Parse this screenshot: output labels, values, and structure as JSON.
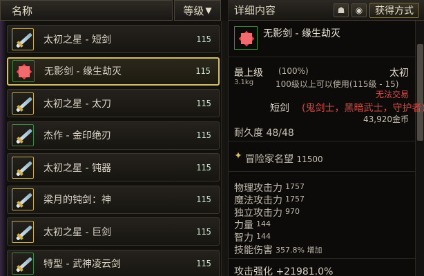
{
  "list": {
    "header": {
      "name_label": "名称",
      "level_label": "等级"
    },
    "items": [
      {
        "name": "太初之星 - 短剑",
        "level": "115",
        "icon": "sword-icon",
        "frame": "gold",
        "selected": false
      },
      {
        "name": "无影剑 - 缘生劫灭",
        "level": "115",
        "icon": "red-burst-icon",
        "frame": "green",
        "selected": true
      },
      {
        "name": "太初之星 - 太刀",
        "level": "115",
        "icon": "sword-icon",
        "frame": "gold",
        "selected": false
      },
      {
        "name": "杰作 - 金印绝刃",
        "level": "115",
        "icon": "sword-icon",
        "frame": "green",
        "selected": false
      },
      {
        "name": "太初之星 - 钝器",
        "level": "115",
        "icon": "sword-icon",
        "frame": "gold",
        "selected": false
      },
      {
        "name": "梁月的钝剑：神",
        "level": "115",
        "icon": "sword-icon",
        "frame": "gold",
        "selected": false
      },
      {
        "name": "太初之星 - 巨剑",
        "level": "115",
        "icon": "sword-icon",
        "frame": "gold",
        "selected": false
      },
      {
        "name": "特型 - 武神凌云剑",
        "level": "115",
        "icon": "sword-icon",
        "frame": "green",
        "selected": false
      }
    ]
  },
  "detail": {
    "header_title": "详细内容",
    "btn_a": "☗",
    "btn_b": "◉",
    "obtain_label": "获得方式",
    "item_name": "无影剑 - 缘生劫灭",
    "grade_label": "最上级",
    "grade_pct": "(100%)",
    "grade_suffix": "太初",
    "weight": "3.1kg",
    "usable": "100级以上可以使用(115级 - 15)",
    "no_trade": "无法交易",
    "weapon_type": "短剑",
    "classes": "(鬼剑士，黑暗武士，守护者)",
    "price": "43,920金币",
    "durability": "耐久度 48/48",
    "fame_label": "冒险家名望",
    "fame_value": "11500",
    "stats": [
      {
        "label": "物理攻击力",
        "value": "1757"
      },
      {
        "label": "魔法攻击力",
        "value": "1757"
      },
      {
        "label": "独立攻击力",
        "value": "970"
      },
      {
        "label": "力量",
        "value": "144"
      },
      {
        "label": "智力",
        "value": "144"
      },
      {
        "label": "技能伤害",
        "value": "357.8% 增加"
      }
    ],
    "attack_strength": "攻击强化 +21981.0%"
  },
  "colors": {
    "selected_border": "#d4c06a",
    "red_text": "#e14a4a",
    "green_frame": "#3d8a44",
    "gold_frame": "#cfae52"
  }
}
